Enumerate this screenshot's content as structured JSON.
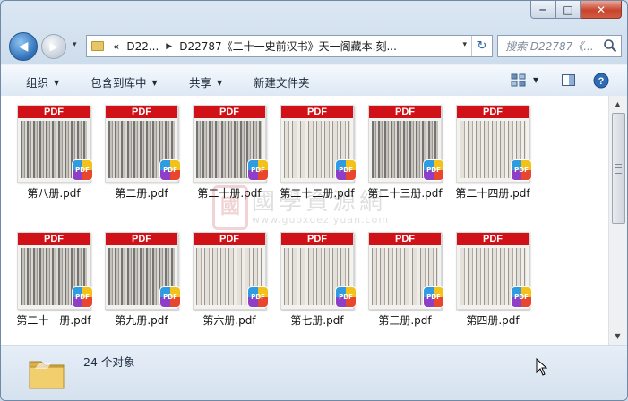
{
  "window": {
    "controls": {
      "minimize": "─",
      "maximize": "□",
      "close": "✕"
    }
  },
  "nav": {
    "back_glyph": "◀",
    "forward_glyph": "▶",
    "dropdown_glyph": "▾",
    "breadcrumb": {
      "overflow": "«",
      "parent": "D22...",
      "current": "D22787《二十一史前汉书》天一阁藏本.刻..."
    },
    "refresh_glyph": "↻",
    "search_placeholder": "搜索 D22787《..."
  },
  "toolbar": {
    "organize": "组织",
    "include_in_library": "包含到库中",
    "share": "共享",
    "new_folder": "新建文件夹"
  },
  "files": [
    {
      "name": "第八册.pdf",
      "label": "PDF",
      "badge": "PDF"
    },
    {
      "name": "第二册.pdf",
      "label": "PDF",
      "badge": "PDF"
    },
    {
      "name": "第二十册.pdf",
      "label": "PDF",
      "badge": "PDF"
    },
    {
      "name": "第二十二册.pdf",
      "label": "PDF",
      "badge": "PDF"
    },
    {
      "name": "第二十三册.pdf",
      "label": "PDF",
      "badge": "PDF"
    },
    {
      "name": "第二十四册.pdf",
      "label": "PDF",
      "badge": "PDF"
    },
    {
      "name": "第二十一册.pdf",
      "label": "PDF",
      "badge": "PDF"
    },
    {
      "name": "第九册.pdf",
      "label": "PDF",
      "badge": "PDF"
    },
    {
      "name": "第六册.pdf",
      "label": "PDF",
      "badge": "PDF"
    },
    {
      "name": "第七册.pdf",
      "label": "PDF",
      "badge": "PDF"
    },
    {
      "name": "第三册.pdf",
      "label": "PDF",
      "badge": "PDF"
    },
    {
      "name": "第四册.pdf",
      "label": "PDF",
      "badge": "PDF"
    }
  ],
  "watermark": {
    "seal": "國",
    "text": "國學資源網",
    "url": "www.guoxueziyuan.com"
  },
  "status": {
    "count": "24 个对象"
  },
  "colors": {
    "pdf_red": "#d01218",
    "close_red": "#c8442d",
    "frame_blue": "#cddcec"
  }
}
